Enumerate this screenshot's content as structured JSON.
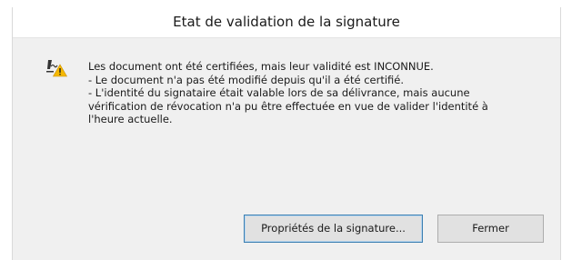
{
  "dialog": {
    "title": "Etat de validation de la signature",
    "icon": "signature-warning-icon",
    "message_lines": [
      "Les document ont été certifiées, mais leur validité est INCONNUE.",
      "- Le document n'a pas été modifié depuis qu'il a été certifié.",
      "- L'identité du signataire était valable lors de sa délivrance, mais aucune vérification de révocation n'a pu être effectuée en vue de valider l'identité à l'heure actuelle."
    ],
    "buttons": {
      "properties_label": "Propriétés de la signature...",
      "close_label": "Fermer"
    },
    "colors": {
      "warning": "#f5b800",
      "focus_border": "#3c7fb1"
    }
  }
}
